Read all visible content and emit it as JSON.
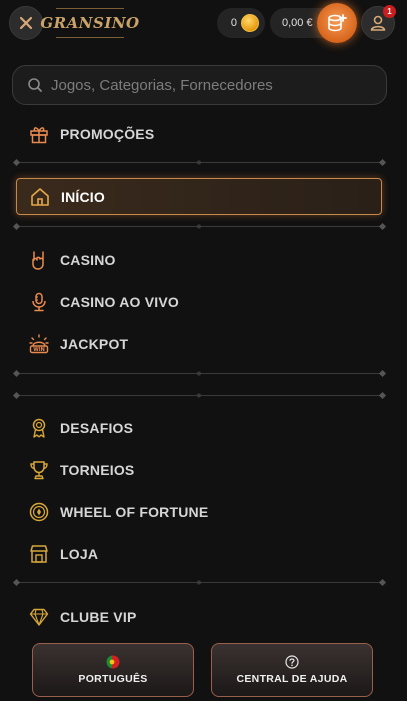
{
  "header": {
    "logo_text": "GRANSINO",
    "coins_value": "0",
    "balance_value": "0,00 €",
    "notification_count": "1"
  },
  "search": {
    "placeholder": "Jogos, Categorias, Fornecedores"
  },
  "menu": {
    "promocoes": "PROMOÇÕES",
    "inicio": "INÍCIO",
    "casino": "CASINO",
    "casino_ao_vivo": "CASINO AO VIVO",
    "jackpot": "JACKPOT",
    "desafios": "DESAFIOS",
    "torneios": "TORNEIOS",
    "wheel_of_fortune": "WHEEL OF FORTUNE",
    "loja": "LOJA",
    "clube_vip": "CLUBE VIP"
  },
  "footer": {
    "language_label": "PORTUGUÊS",
    "help_label": "CENTRAL DE AJUDA"
  },
  "icons": {
    "close": "close-icon",
    "coin": "coin-icon",
    "deposit": "coins-stack-plus-icon",
    "profile": "user-icon",
    "search": "search-icon",
    "gift": "gift-icon",
    "home": "home-icon",
    "casino": "rock-hand-icon",
    "live": "microphone-icon",
    "jackpot": "jackpot-win-icon",
    "challenges": "medal-icon",
    "tournaments": "trophy-icon",
    "wheel": "wheel-icon",
    "shop": "shop-icon",
    "vip": "diamond-icon",
    "language": "portugal-flag-icon",
    "help": "question-icon"
  },
  "colors": {
    "background": "#111111",
    "accent_orange": "#e98a4e",
    "accent_gold": "#d8a73a",
    "active_border": "#c88a4a"
  }
}
